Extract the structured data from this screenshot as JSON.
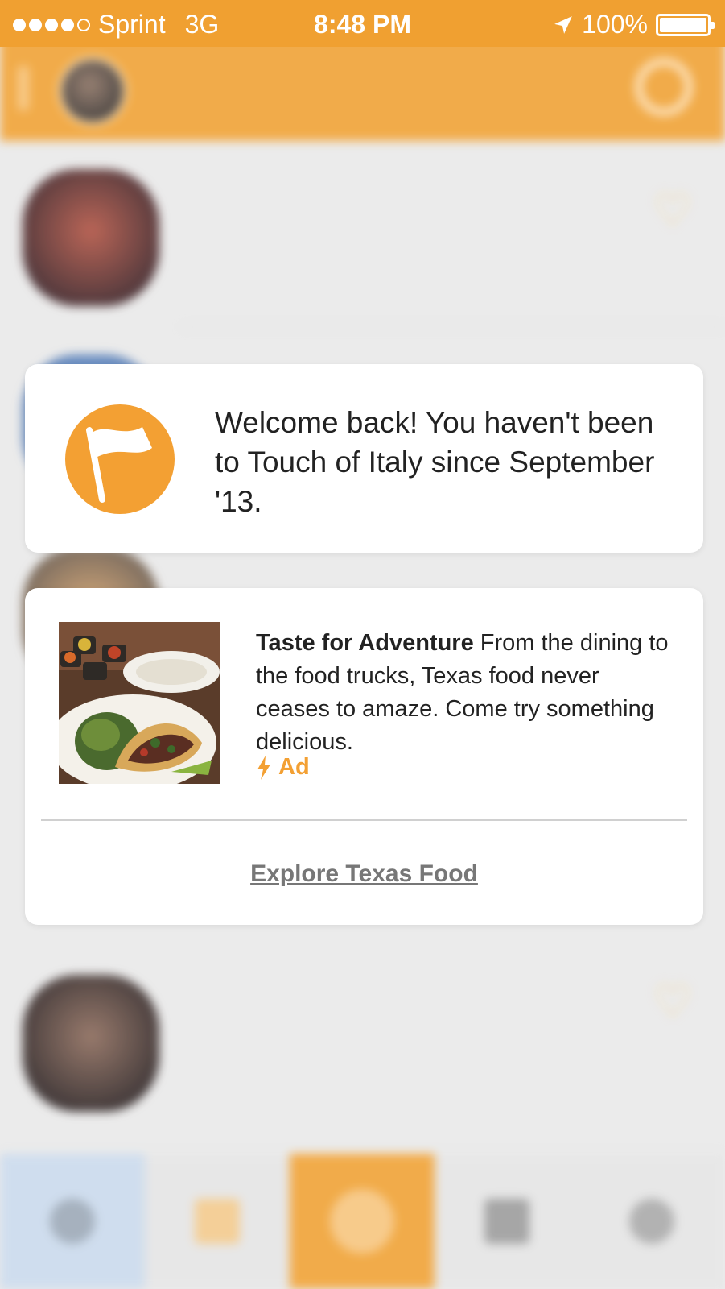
{
  "status_bar": {
    "carrier": "Sprint",
    "network": "3G",
    "time": "8:48 PM",
    "battery": "100%"
  },
  "welcome_card": {
    "message": "Welcome back! You haven't been to Touch of Italy since September '13."
  },
  "ad_card": {
    "headline": "Taste for Adventure",
    "body": "From the dining to the food trucks, Texas food never ceases to amaze. Come try something delicious.",
    "tag": "Ad",
    "cta": "Explore Texas Food"
  },
  "colors": {
    "brand_orange": "#f0a031",
    "card_bg": "#ffffff",
    "link_gray": "#777777"
  }
}
